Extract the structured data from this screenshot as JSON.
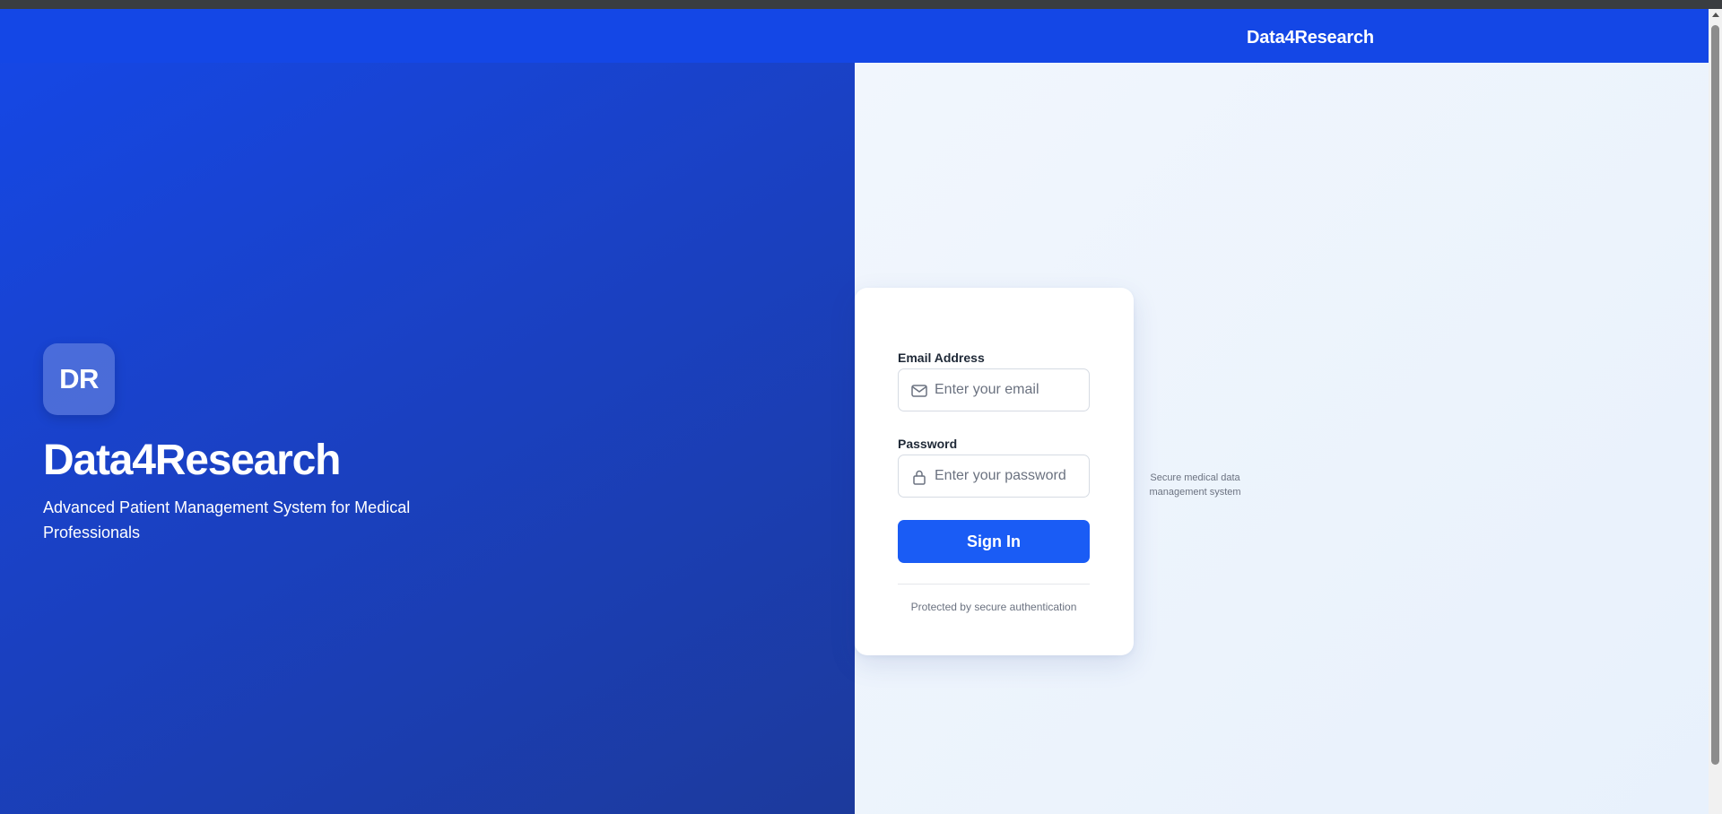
{
  "nav": {
    "brand": "Data4Research"
  },
  "hero": {
    "logo_initials": "DR",
    "title": "Data4Research",
    "subtitle": "Advanced Patient Management System for Medical Professionals"
  },
  "login": {
    "email_label": "Email Address",
    "email_placeholder": "Enter your email",
    "email_value": "",
    "email_icon": "mail-icon",
    "password_label": "Password",
    "password_placeholder": "Enter your password",
    "password_value": "",
    "password_icon": "lock-icon",
    "submit_label": "Sign In",
    "footer_note": "Protected by secure authentication"
  },
  "side_note": "Secure medical data management system",
  "colors": {
    "primary": "#1a5cf5",
    "nav_bg": "#1447e6",
    "hero_start": "#1548e8",
    "hero_end": "#1c3a9c",
    "right_bg": "#eef5fd"
  }
}
